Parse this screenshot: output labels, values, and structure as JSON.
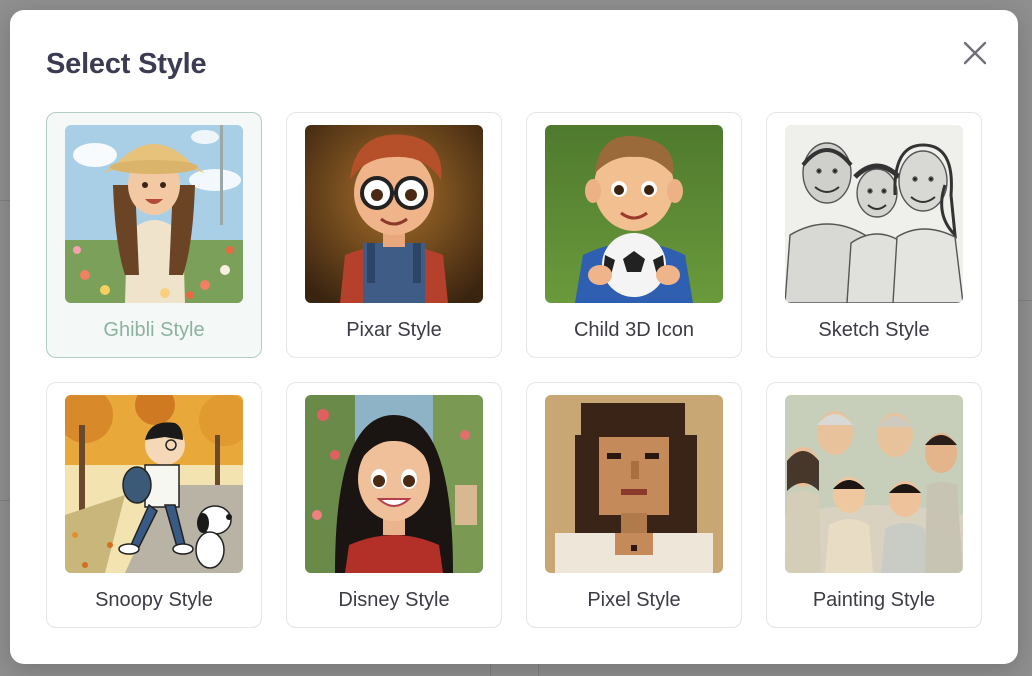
{
  "modal": {
    "title": "Select Style",
    "close_icon": "close-icon"
  },
  "styles": [
    {
      "label": "Ghibli Style",
      "selected": true,
      "icon": "ghibli-style-thumbnail"
    },
    {
      "label": "Pixar Style",
      "selected": false,
      "icon": "pixar-style-thumbnail"
    },
    {
      "label": "Child 3D Icon",
      "selected": false,
      "icon": "child-3d-icon-thumbnail"
    },
    {
      "label": "Sketch Style",
      "selected": false,
      "icon": "sketch-style-thumbnail"
    },
    {
      "label": "Snoopy Style",
      "selected": false,
      "icon": "snoopy-style-thumbnail"
    },
    {
      "label": "Disney Style",
      "selected": false,
      "icon": "disney-style-thumbnail"
    },
    {
      "label": "Pixel Style",
      "selected": false,
      "icon": "pixel-style-thumbnail"
    },
    {
      "label": "Painting Style",
      "selected": false,
      "icon": "painting-style-thumbnail"
    }
  ],
  "colors": {
    "accent_selected": "#8cb39f",
    "title": "#3b3c52"
  }
}
